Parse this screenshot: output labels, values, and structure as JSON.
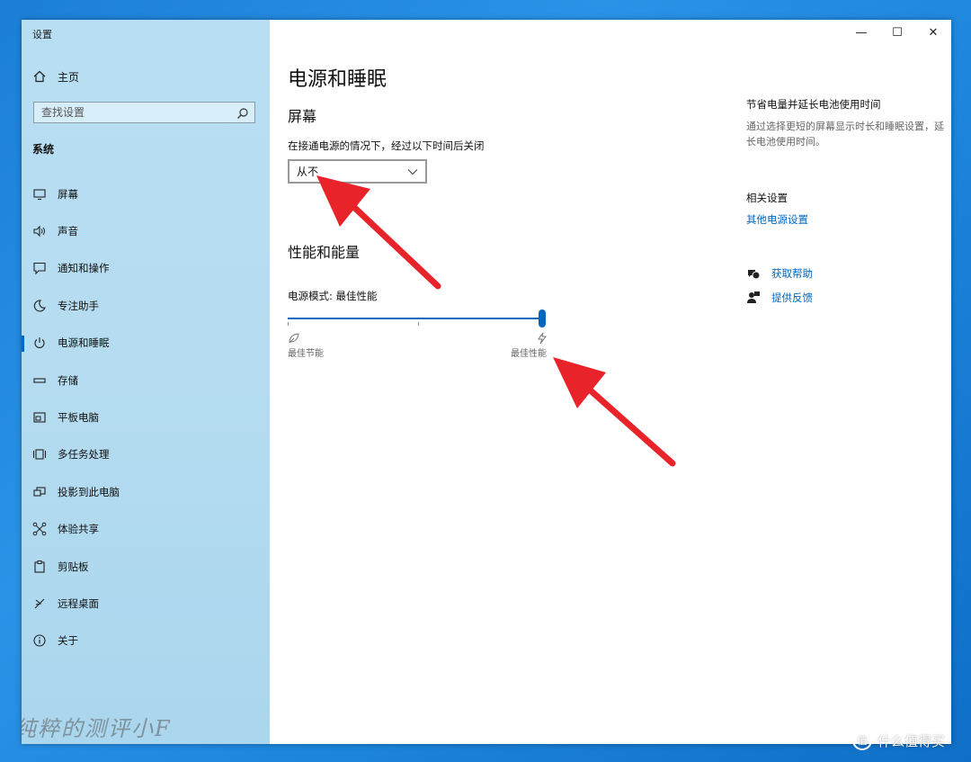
{
  "window": {
    "title": "设置"
  },
  "controls": {
    "minimize": "—",
    "maximize": "☐",
    "close": "✕"
  },
  "sidebar": {
    "home_label": "主页",
    "search_placeholder": "查找设置",
    "section_title": "系统",
    "items": [
      {
        "label": "屏幕",
        "icon": "monitor-icon"
      },
      {
        "label": "声音",
        "icon": "speaker-icon"
      },
      {
        "label": "通知和操作",
        "icon": "notification-icon"
      },
      {
        "label": "专注助手",
        "icon": "moon-icon"
      },
      {
        "label": "电源和睡眠",
        "icon": "power-icon",
        "active": true
      },
      {
        "label": "存储",
        "icon": "storage-icon"
      },
      {
        "label": "平板电脑",
        "icon": "tablet-icon"
      },
      {
        "label": "多任务处理",
        "icon": "multitask-icon"
      },
      {
        "label": "投影到此电脑",
        "icon": "project-icon"
      },
      {
        "label": "体验共享",
        "icon": "share-icon"
      },
      {
        "label": "剪贴板",
        "icon": "clipboard-icon"
      },
      {
        "label": "远程桌面",
        "icon": "remote-desktop-icon"
      },
      {
        "label": "关于",
        "icon": "info-icon"
      }
    ],
    "watermark": "纯粹的测评小F"
  },
  "main": {
    "title": "电源和睡眠",
    "screen_heading": "屏幕",
    "screen_label": "在接通电源的情况下，经过以下时间后关闭",
    "screen_value": "从不",
    "perf_heading": "性能和能量",
    "power_mode_label": "电源模式: 最佳性能",
    "slider": {
      "value_fraction": 1.0,
      "left_label": "最佳节能",
      "right_label": "最佳性能"
    }
  },
  "right_panel": {
    "save_heading": "节省电量并延长电池使用时间",
    "save_text": "通过选择更短的屏幕显示时长和睡眠设置，延长电池使用时间。",
    "related_heading": "相关设置",
    "related_link": "其他电源设置",
    "help_link": "获取帮助",
    "feedback_link": "提供反馈"
  },
  "brand": {
    "logo": "值",
    "text": "什么值得买"
  },
  "colors": {
    "accent": "#0067c0",
    "arrow": "#e8232a"
  }
}
